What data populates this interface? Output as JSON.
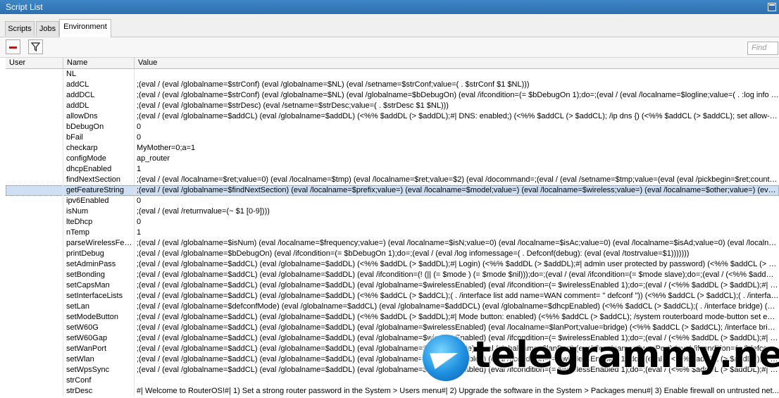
{
  "window": {
    "title": "Script List"
  },
  "tabs": [
    {
      "label": "Scripts"
    },
    {
      "label": "Jobs"
    },
    {
      "label": "Environment"
    }
  ],
  "toolbar": {
    "remove_icon": "minus-icon",
    "filter_icon": "filter-icon",
    "find_placeholder": "Find"
  },
  "columns": {
    "user": "User",
    "name": "Name",
    "value": "Value"
  },
  "rows": [
    {
      "name": "NL",
      "value": ""
    },
    {
      "name": "addCL",
      "value": ";(eval / (eval /globalname=$strConf) (eval /globalname=$NL) (eval /setname=$strConf;value=( .  $strConf $1 $NL)))"
    },
    {
      "name": "addDCL",
      "value": ";(eval / (eval /globalname=$strConf) (eval /globalname=$NL) (eval /globalname=$bDebugOn) (eval /ifcondition=(= $bDebugOn 1);do=;(eval / (eval /localname=$logline;value=( .  :log info  \" ..."
    },
    {
      "name": "addDL",
      "value": ";(eval / (eval /globalname=$strDesc) (eval /setname=$strDesc;value=( .  $strDesc $1 $NL)))"
    },
    {
      "name": "allowDns",
      "value": ";(eval / (eval /globalname=$addCL) (eval /globalname=$addDL) (<%% $addDL (> $addDL);#|    DNS: enabled;) (<%% $addCL (> $addCL); /ip dns {) (<%% $addCL (> $addCL);     set allow-re..."
    },
    {
      "name": "bDebugOn",
      "value": "0"
    },
    {
      "name": "bFail",
      "value": "0"
    },
    {
      "name": "checkarp",
      "value": "MyMother=0;a=1"
    },
    {
      "name": "configMode",
      "value": "ap_router"
    },
    {
      "name": "dhcpEnabled",
      "value": "1"
    },
    {
      "name": "findNextSection",
      "value": ";(eval / (eval /localname=$ret;value=0) (eval /localname=$tmp) (eval /localname=$ret;value=$2) (eval /docommand=;(eval / (eval /setname=$tmp;value=(eval (eval /pickbegin=$ret;counter..."
    },
    {
      "name": "getFeatureString",
      "value": ";(eval / (eval /globalname=$findNextSection) (eval /localname=$prefix;value=) (eval /localname=$model;value=) (eval /localname=$wireless;value=) (eval /localname=$other;value=) (eval /l..."
    },
    {
      "name": "ipv6Enabled",
      "value": "0"
    },
    {
      "name": "isNum",
      "value": ";(eval / (eval /returnvalue=(~ $1 [0-9])))"
    },
    {
      "name": "lteDhcp",
      "value": "0"
    },
    {
      "name": "nTemp",
      "value": "1"
    },
    {
      "name": "parseWirelessFea...",
      "value": ";(eval / (eval /globalname=$isNum) (eval /localname=$frequency;value=) (eval /localname=$isN;value=0) (eval /localname=$isAc;value=0) (eval /localname=$isAd;value=0) (eval /localnam..."
    },
    {
      "name": "printDebug",
      "value": ";(eval / (eval /globalname=$bDebugOn) (eval /ifcondition=(= $bDebugOn 1);do=;(eval / (eval /log infomessage=( .  Defconf(debug):  (eval (eval /tostrvalue=$1)))))))"
    },
    {
      "name": "setAdminPass",
      "value": ";(eval / (eval /globalname=$addCL) (eval /globalname=$addDL) (<%% $addDL (> $addDL);#| Login) (<%% $addDL (> $addDL);#|     admin user protected by password) (<%% $addCL (> $add..."
    },
    {
      "name": "setBonding",
      "value": ";(eval / (eval /globalname=$addCL) (eval /globalname=$addDL) (eval /ifcondition=(! (|| (= $mode ) (= $mode $nil)));do=;(eval / (eval /ifcondition=(= $mode slave);do=;(eval / (<%% $addCL (> ..."
    },
    {
      "name": "setCapsMan",
      "value": ";(eval / (eval /globalname=$addCL) (eval /globalname=$addDL) (eval /globalname=$wirelessEnabled) (eval /ifcondition=(= $wirelessEnabled 1);do=;(eval / (<%% $addDL (> $addDL);#| CAP..."
    },
    {
      "name": "setInterfaceLists",
      "value": ";(eval / (eval /globalname=$addCL) (eval /globalname=$addDL) (<%% $addCL (> $addCL);( .   /interface list add name=WAN comment= \" defconf \")) (<%% $addCL (> $addCL);( .   /interface..."
    },
    {
      "name": "setLan",
      "value": ";(eval / (eval /globalname=$defconfMode) (eval /globalname=$addCL) (eval /globalname=$addDCL) (eval /globalname=$dhcpEnabled) (<%% $addCL (> $addCL);( .  /interface bridge) (<%% $addD..."
    },
    {
      "name": "setModeButton",
      "value": ";(eval / (eval /globalname=$addCL) (eval /globalname=$addDL) (<%% $addDL (> $addDL);#| Mode button: enabled) (<%% $addCL (> $addCL); /system routerboard mode-button set enabled=yes) (<%% $addCL (> $addCL); /system routerboard..."
    },
    {
      "name": "setW60G",
      "value": ";(eval / (eval /globalname=$addCL) (eval /globalname=$addDL) (eval /globalname=$wirelessEnabled) (eval /localname=$lanPort;value=bridge) (<%% $addCL (> $addCL); /interface bridge) (<%% $addCL (> ..."
    },
    {
      "name": "setW60Gap",
      "value": ";(eval / (eval /globalname=$addCL) (eval /globalname=$addDL) (eval /globalname=$wirelessEnabled) (eval /ifcondition=(= $wirelessEnabled 1);do=;(eval / (<%% $addDL (> $addDL);#| wlan..."
    },
    {
      "name": "setWanPort",
      "value": ";(eval / (eval /globalname=$addCL) (eval /globalname=$addDL) (eval /globalname=$defconfMode) (eval /globalname=$lanPort) (eval /localname=$wanPort) (eval /ifcondition=(= $defconfMode ..."
    },
    {
      "name": "setWlan",
      "value": ";(eval / (eval /globalname=$addCL) (eval /globalname=$addDL) (eval /globalname=$wirelessEnabled) (eval /ifcondition=(= $wirelessEnabled 1);do=;(eval / (<%% $addDL (> $addDL);#| wlan..."
    },
    {
      "name": "setWpsSync",
      "value": ";(eval / (eval /globalname=$addCL) (eval /globalname=$addDL) (eval /globalname=$wirelessEnabled) (eval /ifcondition=(= $wirelessEnabled 1);do=;(eval / (<%% $addDL (> $addDL);#| WP..."
    },
    {
      "name": "strConf",
      "value": ""
    },
    {
      "name": "strDesc",
      "value": "#| Welcome to RouterOS!#|    1) Set a strong router password in the System > Users menu#|    2) Upgrade the software in the System > Packages menu#|    3) Enable firewall on untrusted net..."
    }
  ],
  "watermark": {
    "text": "telegrammy.net",
    "icon": "telegram-logo-icon"
  },
  "colors": {
    "titlebar": "#2f6fae",
    "selected_row": "#cfe0f4"
  }
}
